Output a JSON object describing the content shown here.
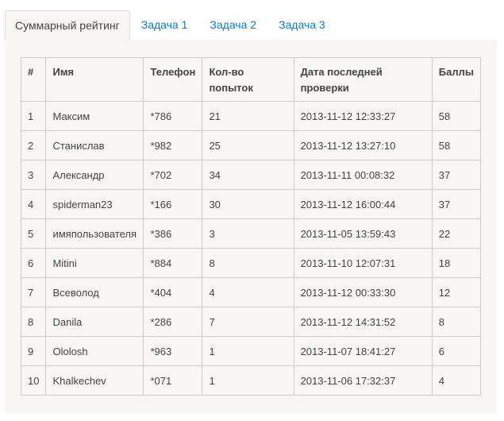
{
  "tabs": [
    "Суммарный рейтинг",
    "Задача 1",
    "Задача 2",
    "Задача 3"
  ],
  "table": {
    "headers": [
      "#",
      "Имя",
      "Телефон",
      "Кол-во попыток",
      "Дата последней проверки",
      "Баллы"
    ],
    "rows": [
      [
        "1",
        "Максим",
        "*786",
        "21",
        "2013-11-12 12:33:27",
        "58"
      ],
      [
        "2",
        "Станислав",
        "*982",
        "25",
        "2013-11-12 13:27:10",
        "58"
      ],
      [
        "3",
        "Александр",
        "*702",
        "34",
        "2013-11-11 00:08:32",
        "37"
      ],
      [
        "4",
        "spiderman23",
        "*166",
        "30",
        "2013-11-12 16:00:44",
        "37"
      ],
      [
        "5",
        "имяпользователя",
        "*386",
        "3",
        "2013-11-05 13:59:43",
        "22"
      ],
      [
        "6",
        "Mitini",
        "*884",
        "8",
        "2013-11-10 12:07:31",
        "18"
      ],
      [
        "7",
        "Всеволод",
        "*404",
        "4",
        "2013-11-12 00:33:30",
        "12"
      ],
      [
        "8",
        "Danila",
        "*286",
        "7",
        "2013-11-12 14:31:52",
        "8"
      ],
      [
        "9",
        "Ololosh",
        "*963",
        "1",
        "2013-11-07 18:41:27",
        "6"
      ],
      [
        "10",
        "Khalkechev",
        "*071",
        "1",
        "2013-11-06 17:32:37",
        "4"
      ]
    ]
  }
}
